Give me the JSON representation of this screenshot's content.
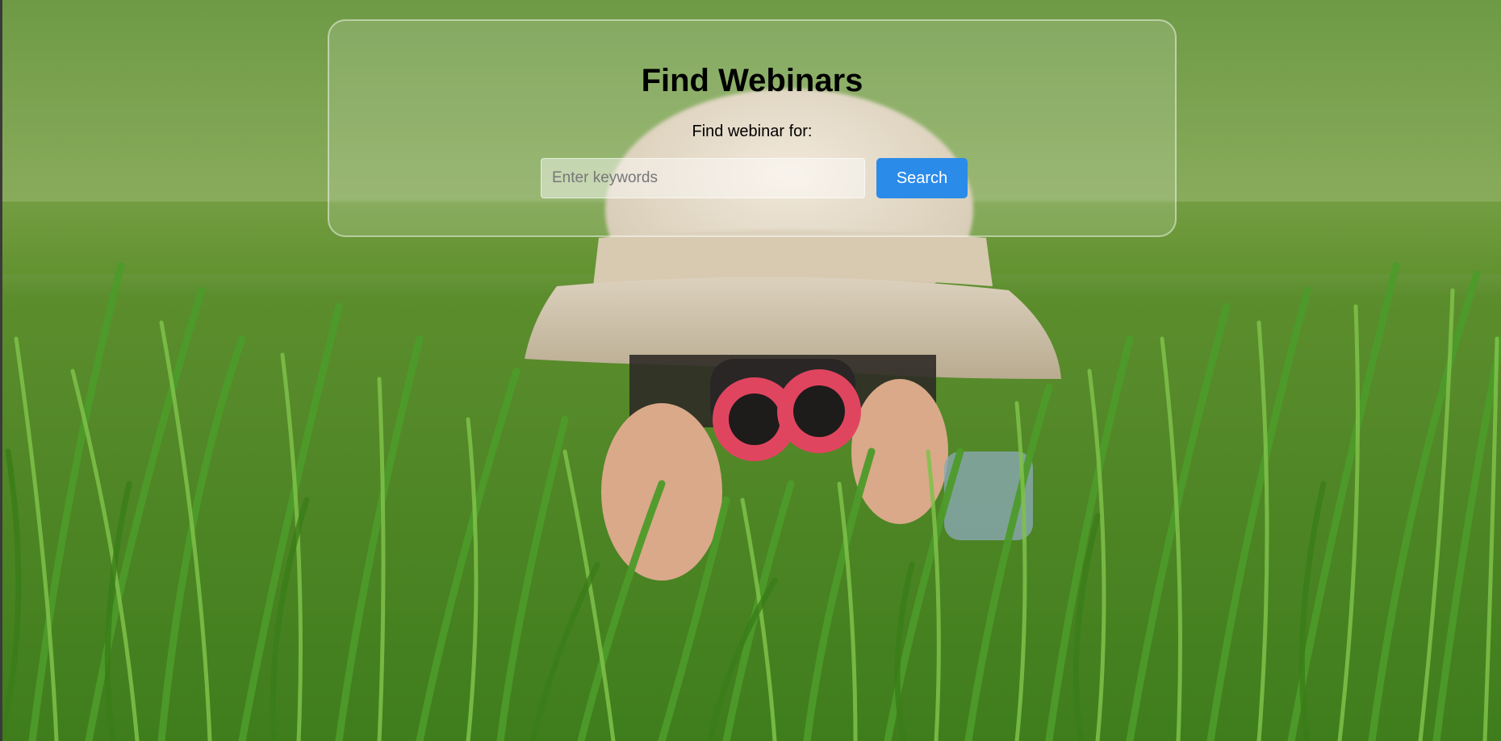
{
  "header": {
    "title": "Find Webinars"
  },
  "search": {
    "label": "Find webinar for:",
    "placeholder": "Enter keywords",
    "value": "",
    "button_label": "Search",
    "button_color": "#2b8be9"
  },
  "background": {
    "subject": "person in pith helmet with red binoculars hiding in tall grass"
  }
}
